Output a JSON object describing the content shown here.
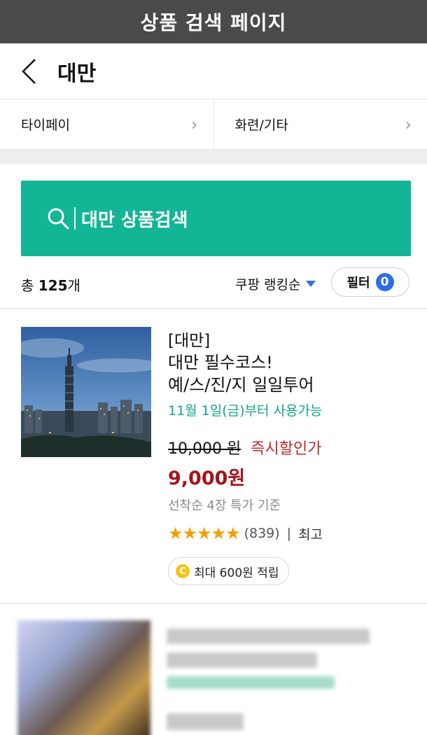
{
  "titlebar": {
    "title": "상품 검색 페이지"
  },
  "nav": {
    "title": "대만",
    "back_icon": "chevron-left-icon"
  },
  "categories": [
    {
      "label": "타이페이"
    },
    {
      "label": "화련/기타"
    }
  ],
  "search": {
    "label": "대만 상품검색",
    "icon": "search-icon"
  },
  "results": {
    "prefix": "총 ",
    "count": "125",
    "suffix": "개"
  },
  "sort": {
    "label": "쿠팡 랭킹순"
  },
  "filter": {
    "label": "필터",
    "count": "0"
  },
  "products": [
    {
      "tag": "[대만]",
      "name_line1": "대만 필수코스!",
      "name_line2": "예/스/진/지 일일투어",
      "availability": "11월 1일(금)부터 사용가능",
      "original_price": "10,000",
      "original_currency": "원",
      "discount_label": "즉시할인가",
      "final_price": "9,000원",
      "condition": "선착순 4장 특가  기준",
      "rating_stars": 5,
      "review_count": "(839)",
      "separator": "|",
      "grade": "최고",
      "reward_coin": "C",
      "reward_label": "최대 600원 적립"
    }
  ],
  "colors": {
    "accent": "#12b596",
    "sale_red": "#c0282d",
    "price_red": "#a3151b",
    "blue": "#2f6ee9",
    "star": "#f5a000"
  }
}
